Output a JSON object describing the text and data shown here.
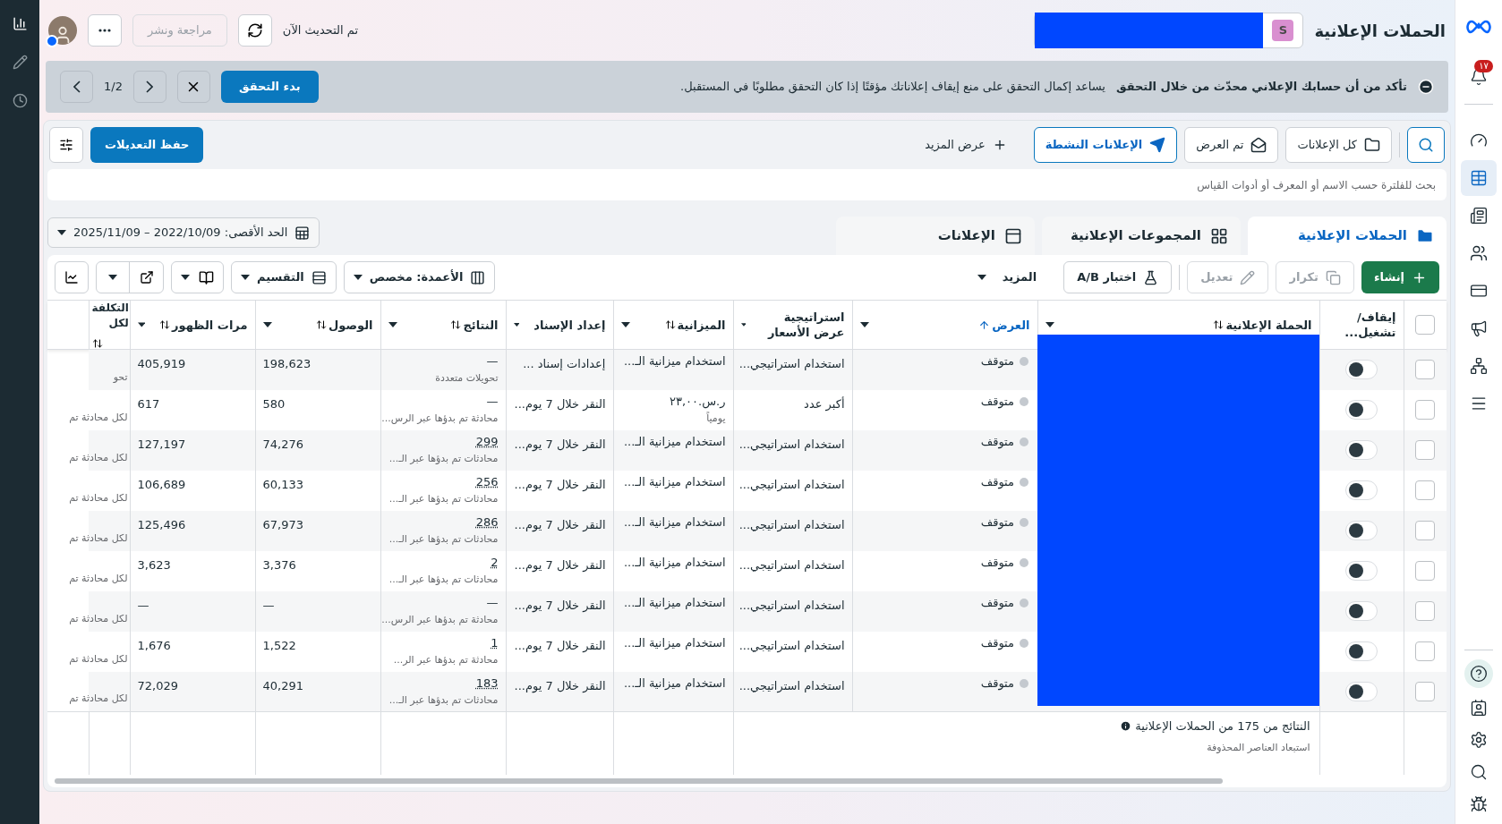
{
  "header": {
    "title": "الحملات الإعلانية",
    "account_badge": "S",
    "status": "تم التحديث الآن",
    "review_button": {
      "label": "مراجعة ونشر",
      "disabled": true
    }
  },
  "notifications_badge": "١٧",
  "right_rail": [
    {
      "kind": "gauge",
      "selected": false
    },
    {
      "kind": "table",
      "selected": true
    },
    {
      "kind": "pages",
      "selected": false
    },
    {
      "kind": "people",
      "selected": false
    },
    {
      "kind": "card",
      "selected": false
    },
    {
      "kind": "megaphone",
      "selected": false
    },
    {
      "kind": "network",
      "selected": false
    },
    {
      "kind": "menu",
      "selected": false
    }
  ],
  "banner": {
    "title": "تأكد من أن حسابك الإعلاني محدّث من خلال التحقق",
    "text": "يساعد إكمال التحقق على منع إيقاف إعلاناتك مؤقتًا إذا كان التحقق مطلوبًا في المستقبل.",
    "primary_button": "بدء التحقق",
    "pager": "1/2"
  },
  "view_filters": [
    {
      "label": "كل الإعلانات",
      "kind": "folder",
      "selected": false
    },
    {
      "label": "تم العرض",
      "kind": "envelope",
      "selected": false
    },
    {
      "label": "الإعلانات النشطة",
      "kind": "send",
      "selected": true
    }
  ],
  "show_more": "عرض المزيد",
  "save_button": "حفظ التعديلات",
  "search": {
    "placeholder": "بحث للفلترة حسب الاسم أو المعرف أو أدوات القياس"
  },
  "date_range": "الحد الأقصى: 2022/10/09 – 2025/11/09",
  "tabs": [
    {
      "label": "الحملات الإعلانية",
      "kind": "campaigns",
      "selected": true
    },
    {
      "label": "المجموعات الإعلانية",
      "kind": "adsets",
      "selected": false
    },
    {
      "label": "الإعلانات",
      "kind": "ads",
      "selected": false
    }
  ],
  "actions": [
    {
      "label": "إنشاء",
      "kind": "create",
      "disabled": false
    },
    {
      "label": "تكرار",
      "kind": "duplicate",
      "disabled": true
    },
    {
      "label": "تعديل",
      "kind": "edit",
      "disabled": true
    },
    {
      "label": "اختبار A/B",
      "kind": "ab_test",
      "disabled": false
    }
  ],
  "more_menu": "المزيد",
  "view_controls": {
    "columns": "الأعمدة: مخصص",
    "breakdown": "التقسيم"
  },
  "table": {
    "all_selected": false,
    "columns": [
      {
        "label": "إيقاف/ تشغيل...",
        "sortable": false,
        "sorted": false,
        "menu": false
      },
      {
        "label": "الحملة الإعلانية",
        "sortable": true,
        "sorted": false,
        "menu": true
      },
      {
        "label": "العرض",
        "sortable": true,
        "sorted": true,
        "menu": true
      },
      {
        "label": "استراتيجية عرض الأسعار",
        "sortable": false,
        "sorted": false,
        "menu": true
      },
      {
        "label": "الميزانية",
        "sortable": true,
        "sorted": false,
        "menu": true
      },
      {
        "label": "إعداد الإسناد",
        "sortable": false,
        "sorted": false,
        "menu": true
      },
      {
        "label": "النتائج",
        "sortable": true,
        "sorted": false,
        "menu": true
      },
      {
        "label": "الوصول",
        "sortable": true,
        "sorted": false,
        "menu": true
      },
      {
        "label": "مرات الظهور",
        "sortable": true,
        "sorted": false,
        "menu": true
      },
      {
        "label": "التكلفة لكل",
        "sortable": true,
        "sorted": false,
        "menu": false
      }
    ],
    "rows": [
      {
        "checked": false,
        "on": false,
        "delivery": "متوقف",
        "bid": "استخدام استراتيجي...",
        "budget": "استخدام ميزانية الـ...",
        "budget_sub": null,
        "attribution": "إعدادات إسناد ...",
        "result": "—",
        "dotted": false,
        "result_sub": "تحويلات متعددة",
        "reach": "198,623",
        "impressions": "405,919",
        "cost_sub": "تحو"
      },
      {
        "checked": false,
        "on": false,
        "delivery": "متوقف",
        "bid": "أكبر عدد",
        "budget": "ر.س.٢٣,٠٠",
        "budget_sub": "يومياً",
        "attribution": "النقر خلال 7 يوم...",
        "result": "—",
        "dotted": false,
        "result_sub": "محادثة تم بدؤها عبر الرس...",
        "reach": "580",
        "impressions": "617",
        "cost_sub": "لكل محادثة تم"
      },
      {
        "checked": false,
        "on": false,
        "delivery": "متوقف",
        "bid": "استخدام استراتيجي...",
        "budget": "استخدام ميزانية الـ...",
        "budget_sub": null,
        "attribution": "النقر خلال 7 يوم...",
        "result": "299",
        "dotted": true,
        "result_sub": "محادثات تم بدؤها عبر الـ...",
        "reach": "74,276",
        "impressions": "127,197",
        "cost_sub": "لكل محادثة تم"
      },
      {
        "checked": false,
        "on": false,
        "delivery": "متوقف",
        "bid": "استخدام استراتيجي...",
        "budget": "استخدام ميزانية الـ...",
        "budget_sub": null,
        "attribution": "النقر خلال 7 يوم...",
        "result": "256",
        "dotted": true,
        "result_sub": "محادثات تم بدؤها عبر الـ...",
        "reach": "60,133",
        "impressions": "106,689",
        "cost_sub": "لكل محادثة تم"
      },
      {
        "checked": false,
        "on": false,
        "delivery": "متوقف",
        "bid": "استخدام استراتيجي...",
        "budget": "استخدام ميزانية الـ...",
        "budget_sub": null,
        "attribution": "النقر خلال 7 يوم...",
        "result": "286",
        "dotted": true,
        "result_sub": "محادثات تم بدؤها عبر الـ...",
        "reach": "67,973",
        "impressions": "125,496",
        "cost_sub": "لكل محادثة تم"
      },
      {
        "checked": false,
        "on": false,
        "delivery": "متوقف",
        "bid": "استخدام استراتيجي...",
        "budget": "استخدام ميزانية الـ...",
        "budget_sub": null,
        "attribution": "النقر خلال 7 يوم...",
        "result": "2",
        "dotted": true,
        "result_sub": "محادثات تم بدؤها عبر الـ...",
        "reach": "3,376",
        "impressions": "3,623",
        "cost_sub": "لكل محادثة تم"
      },
      {
        "checked": false,
        "on": false,
        "delivery": "متوقف",
        "bid": "استخدام استراتيجي...",
        "budget": "استخدام ميزانية الـ...",
        "budget_sub": null,
        "attribution": "النقر خلال 7 يوم...",
        "result": "—",
        "dotted": false,
        "result_sub": "محادثة تم بدؤها عبر الرس...",
        "reach": "—",
        "impressions": "—",
        "cost_sub": "لكل محادثة تم"
      },
      {
        "checked": false,
        "on": false,
        "delivery": "متوقف",
        "bid": "استخدام استراتيجي...",
        "budget": "استخدام ميزانية الـ...",
        "budget_sub": null,
        "attribution": "النقر خلال 7 يوم...",
        "result": "1",
        "dotted": true,
        "result_sub": "محادثة تم بدؤها عبر الر...",
        "reach": "1,522",
        "impressions": "1,676",
        "cost_sub": "لكل محادثة تم"
      },
      {
        "checked": false,
        "on": false,
        "delivery": "متوقف",
        "bid": "استخدام استراتيجي...",
        "budget": "استخدام ميزانية الـ...",
        "budget_sub": null,
        "attribution": "النقر خلال 7 يوم...",
        "result": "183",
        "dotted": true,
        "result_sub": "محادثات تم بدؤها عبر الـ...",
        "reach": "40,291",
        "impressions": "72,029",
        "cost_sub": "لكل محادثة تم"
      }
    ],
    "summary": {
      "text": "النتائج من 175 من الحملات الإعلانية",
      "subtext": "استبعاد العناصر المحذوفة"
    }
  }
}
